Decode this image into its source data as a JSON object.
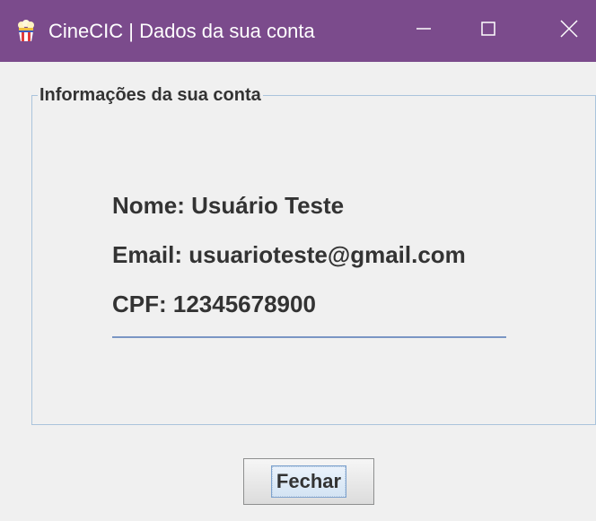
{
  "window": {
    "title": "CineCIC | Dados da sua conta",
    "titlebar_color": "#7b4b8c",
    "icons": {
      "app": "popcorn-icon",
      "minimize": "minimize-icon",
      "maximize": "maximize-icon",
      "close": "close-icon"
    }
  },
  "account": {
    "group_title": "Informações da sua conta",
    "name_line": "Nome: Usuário Teste",
    "email_line": "Email: usuarioteste@gmail.com",
    "cpf_line": "CPF: 12345678900"
  },
  "actions": {
    "close_label": "Fechar"
  }
}
